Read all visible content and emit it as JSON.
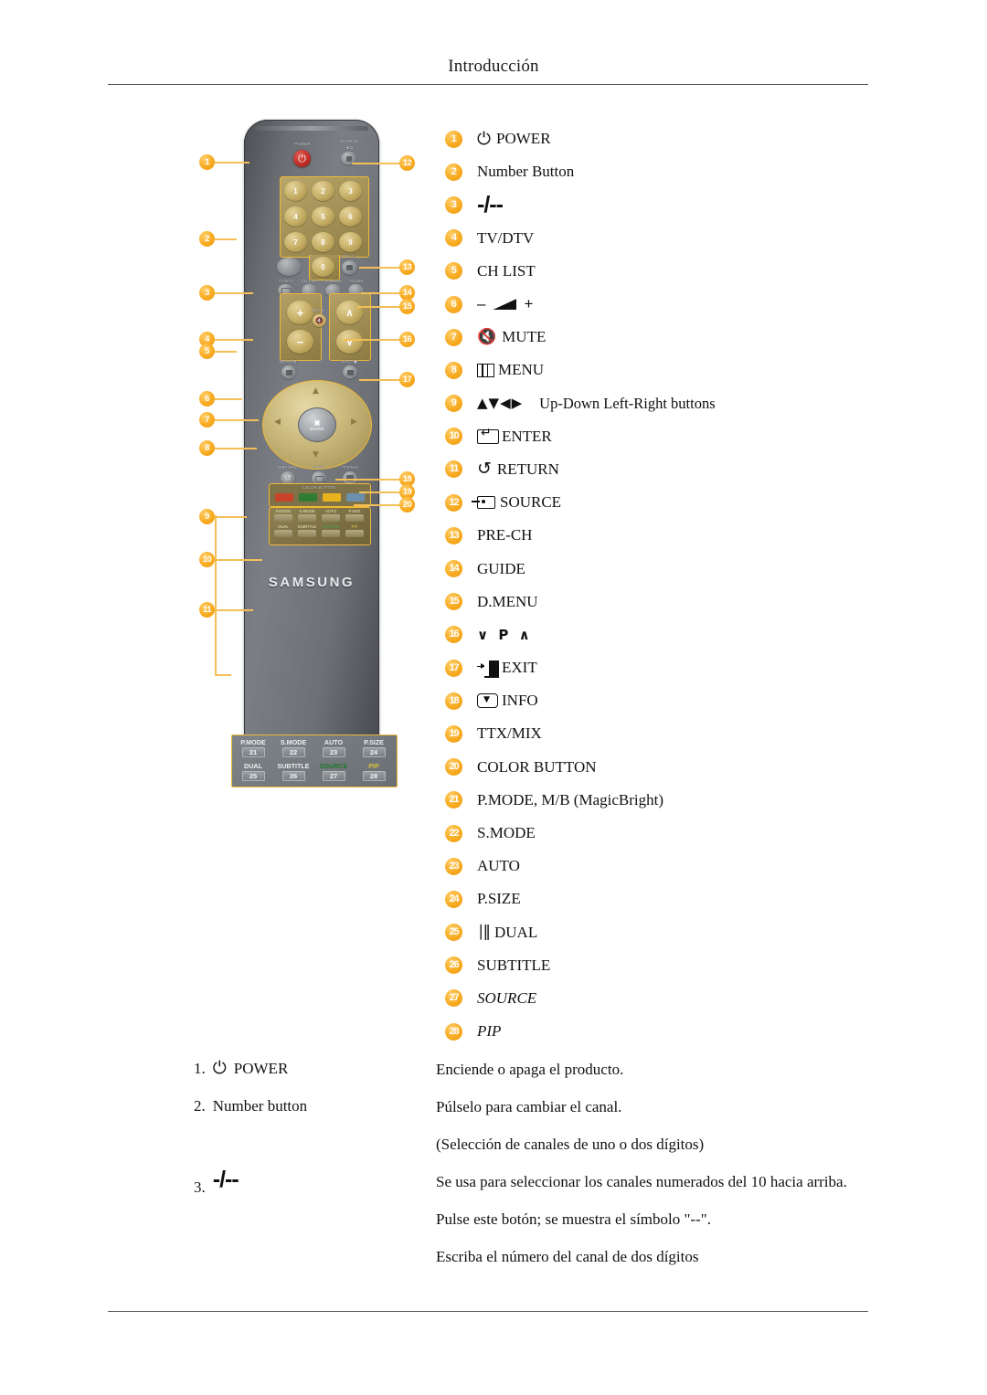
{
  "header": {
    "title": "Introducción"
  },
  "legend": {
    "items": [
      {
        "n": "1",
        "icon": "power-icon",
        "label": "POWER"
      },
      {
        "n": "2",
        "icon": "",
        "label": "Number Button"
      },
      {
        "n": "3",
        "icon": "dash-slash-icon",
        "label": "-/--"
      },
      {
        "n": "4",
        "icon": "",
        "label": "TV/DTV"
      },
      {
        "n": "5",
        "icon": "",
        "label": "CH LIST"
      },
      {
        "n": "6",
        "icon": "volume-icon",
        "label": "− ◢ +"
      },
      {
        "n": "7",
        "icon": "mute-icon",
        "label": "MUTE"
      },
      {
        "n": "8",
        "icon": "menu-icon",
        "label": "MENU"
      },
      {
        "n": "9",
        "icon": "direction-arrows-icon",
        "label": "",
        "note": "Up-Down Left-Right buttons"
      },
      {
        "n": "10",
        "icon": "enter-icon",
        "label": "ENTER"
      },
      {
        "n": "11",
        "icon": "return-icon",
        "label": "RETURN"
      },
      {
        "n": "12",
        "icon": "source-icon",
        "label": "SOURCE"
      },
      {
        "n": "13",
        "icon": "",
        "label": "PRE-CH"
      },
      {
        "n": "14",
        "icon": "",
        "label": "GUIDE"
      },
      {
        "n": "15",
        "icon": "",
        "label": "D.MENU"
      },
      {
        "n": "16",
        "icon": "channel-updown-icon",
        "label": "∨ P ∧"
      },
      {
        "n": "17",
        "icon": "exit-icon",
        "label": "EXIT"
      },
      {
        "n": "18",
        "icon": "info-icon",
        "label": "INFO"
      },
      {
        "n": "19",
        "icon": "",
        "label": "TTX/MIX"
      },
      {
        "n": "20",
        "icon": "",
        "label": "COLOR BUTTON"
      },
      {
        "n": "21",
        "icon": "",
        "label": "P.MODE, M/B (MagicBright)"
      },
      {
        "n": "22",
        "icon": "",
        "label": "S.MODE"
      },
      {
        "n": "23",
        "icon": "",
        "label": "AUTO"
      },
      {
        "n": "24",
        "icon": "",
        "label": "P.SIZE"
      },
      {
        "n": "25",
        "icon": "dual-icon",
        "label": "DUAL"
      },
      {
        "n": "26",
        "icon": "",
        "label": "SUBTITLE"
      },
      {
        "n": "27",
        "icon": "",
        "label": "SOURCE",
        "italic": true
      },
      {
        "n": "28",
        "icon": "",
        "label": "PIP",
        "italic": true
      }
    ]
  },
  "descriptions": [
    {
      "num": "1.",
      "icon": "power-icon",
      "term": "POWER",
      "lines": [
        "Enciende o apaga el producto."
      ]
    },
    {
      "num": "2.",
      "icon": "",
      "term": "Number button",
      "lines": [
        "Púlselo para cambiar el canal.",
        "(Selección de canales de uno o dos dígitos)"
      ]
    },
    {
      "num": "3.",
      "icon": "dash-slash-icon",
      "term": "-/--",
      "lines": [
        "Se usa para seleccionar los canales numerados del 10 hacia arriba.",
        "Pulse este botón; se muestra el símbolo \"--\".",
        "Escriba el número del canal de dos dígitos"
      ]
    }
  ],
  "remote": {
    "brand": "SAMSUNG",
    "labels": {
      "power": "POWER",
      "source": "SOURCE",
      "source_sub": "◄⊐",
      "pre_ch": "PRE-CH",
      "tv_dtv": "TV/DTV",
      "ch_list": "CH LIST",
      "d_menu": "D.MENU",
      "guide": "GUIDE",
      "mute": "MUTE",
      "menu": "MENU/⊞",
      "exit": "EXIT/▣",
      "return": "RETURN",
      "info": "INFO",
      "ttx_mix": "TTX/MIX",
      "color_button": "COLOR BUTTON",
      "enter": "ENTER"
    },
    "numpad": [
      "1",
      "2",
      "3",
      "4",
      "5",
      "6",
      "7",
      "8",
      "9",
      "0"
    ],
    "volume": {
      "plus": "+",
      "minus": "−"
    },
    "channel": {
      "up": "∧",
      "down": "∨"
    },
    "color_bars": [
      "#c8432a",
      "#2e7d32",
      "#e8b31c",
      "#6d8fae"
    ],
    "function_keys": [
      {
        "name": "P.MODE",
        "num": "21"
      },
      {
        "name": "S.MODE",
        "num": "22"
      },
      {
        "name": "AUTO",
        "num": "23"
      },
      {
        "name": "P.SIZE",
        "num": "24"
      },
      {
        "name": "DUAL",
        "num": "25"
      },
      {
        "name": "SUBTITLE",
        "num": "26"
      },
      {
        "name": "SOURCE",
        "num": "27"
      },
      {
        "name": "PIP",
        "num": "28"
      }
    ],
    "callouts": [
      "1",
      "2",
      "3",
      "4",
      "5",
      "6",
      "7",
      "8",
      "9",
      "10",
      "11",
      "12",
      "13",
      "14",
      "15",
      "16",
      "17",
      "18",
      "19",
      "20"
    ]
  },
  "legend_grid": {
    "cells": [
      {
        "name": "P.MODE",
        "num": "21",
        "color": "white"
      },
      {
        "name": "S.MODE",
        "num": "22",
        "color": "white"
      },
      {
        "name": "AUTO",
        "num": "23",
        "color": "white"
      },
      {
        "name": "P.SIZE",
        "num": "24",
        "color": "white"
      },
      {
        "name": "DUAL",
        "num": "25",
        "color": "white"
      },
      {
        "name": "SUBTITLE",
        "num": "26",
        "color": "white"
      },
      {
        "name": "SOURCE",
        "num": "27",
        "color": "green"
      },
      {
        "name": "PIP",
        "num": "28",
        "color": "yellow"
      }
    ]
  },
  "colors": {
    "badge": "#f8ab21",
    "leader": "#f3bf57",
    "rule": "#555555",
    "power_key": "#c22f28"
  }
}
